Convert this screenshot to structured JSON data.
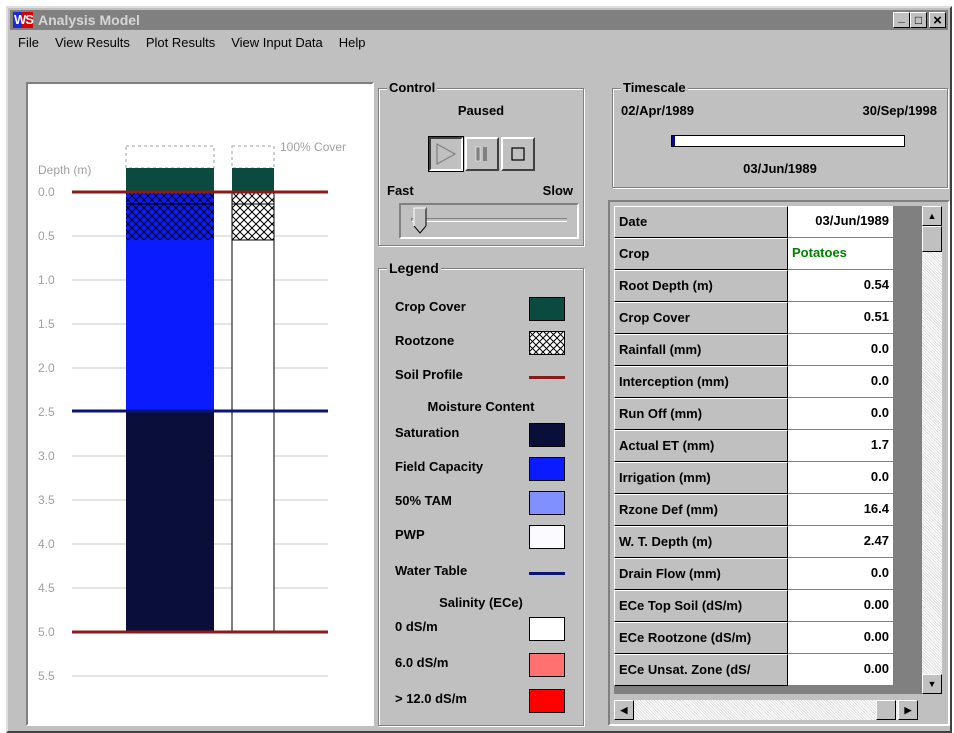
{
  "window": {
    "icon_text": "WS",
    "title": "Analysis Model",
    "btn_min": "_",
    "btn_max": "□",
    "btn_close": "×"
  },
  "menu": [
    "File",
    "View Results",
    "Plot Results",
    "View Input Data",
    "Help"
  ],
  "profile": {
    "depth_label": "Depth (m)",
    "cover_label": "100% Cover",
    "depth_ticks": [
      "0.0",
      "0.5",
      "1.0",
      "1.5",
      "2.0",
      "2.5",
      "3.0",
      "3.5",
      "4.0",
      "4.5",
      "5.0",
      "5.5"
    ]
  },
  "control": {
    "label": "Control",
    "status": "Paused",
    "fast_label": "Fast",
    "slow_label": "Slow"
  },
  "timescale": {
    "label": "Timescale",
    "start_date": "02/Apr/1989",
    "end_date": "30/Sep/1998",
    "current_date": "03/Jun/1989"
  },
  "legend": {
    "label": "Legend",
    "items": [
      {
        "label": "Crop Cover",
        "color": "#0b4b3f",
        "kind": "swatch"
      },
      {
        "label": "Rootzone",
        "kind": "hatch"
      },
      {
        "label": "Soil Profile",
        "color": "#8b1a1a",
        "kind": "line"
      }
    ],
    "moisture_heading": "Moisture Content",
    "moisture_items": [
      {
        "label": "Saturation",
        "color": "#0a0f3a"
      },
      {
        "label": "Field Capacity",
        "color": "#0a1cff"
      },
      {
        "label": "50% TAM",
        "color": "#8090ff"
      },
      {
        "label": "PWP",
        "color": "#fafaff"
      }
    ],
    "water_table_label": "Water Table",
    "water_table_color": "#0a1478",
    "salinity_heading": "Salinity (ECe)",
    "salinity_items": [
      {
        "label": "0 dS/m",
        "color": "#ffffff"
      },
      {
        "label": "6.0 dS/m",
        "color": "#ff7070"
      },
      {
        "label": "> 12.0 dS/m",
        "color": "#ff0000"
      }
    ]
  },
  "results": {
    "rows": [
      {
        "label": "Date",
        "value": "03/Jun/1989"
      },
      {
        "label": "Crop",
        "value": "Potatoes",
        "color": "#008000"
      },
      {
        "label": "Root Depth (m)",
        "value": "0.54"
      },
      {
        "label": "Crop Cover",
        "value": "0.51"
      },
      {
        "label": "Rainfall (mm)",
        "value": "0.0"
      },
      {
        "label": "Interception (mm)",
        "value": "0.0"
      },
      {
        "label": "Run Off (mm)",
        "value": "0.0"
      },
      {
        "label": "Actual ET (mm)",
        "value": "1.7"
      },
      {
        "label": "Irrigation (mm)",
        "value": "0.0"
      },
      {
        "label": "Rzone Def (mm)",
        "value": "16.4"
      },
      {
        "label": "W. T. Depth (m)",
        "value": "2.47"
      },
      {
        "label": "Drain Flow (mm)",
        "value": "0.0"
      },
      {
        "label": "ECe Top Soil (dS/m)",
        "value": "0.00"
      },
      {
        "label": "ECe Rootzone (dS/m)",
        "value": "0.00"
      },
      {
        "label": "ECe Unsat. Zone (dS/",
        "value": "0.00"
      }
    ]
  }
}
